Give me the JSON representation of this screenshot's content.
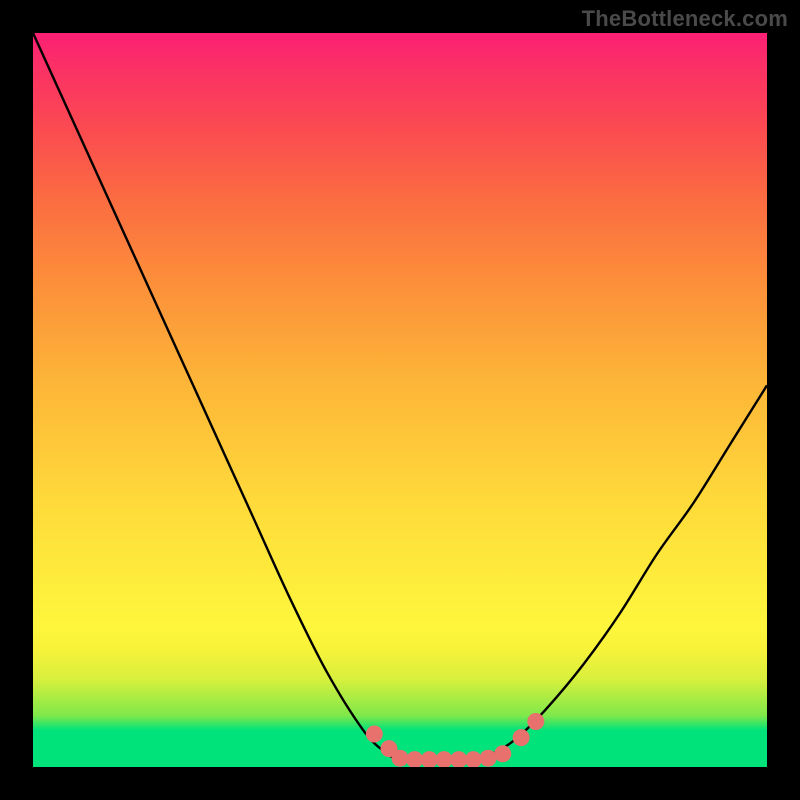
{
  "watermark": "TheBottleneck.com",
  "colors": {
    "curve_stroke": "#000000",
    "marker_fill": "#e8716e",
    "marker_stroke": "#d85a56",
    "background_black": "#000000"
  },
  "chart_data": {
    "type": "line",
    "title": "",
    "xlabel": "",
    "ylabel": "",
    "xlim": [
      0,
      100
    ],
    "ylim": [
      0,
      100
    ],
    "x": [
      0,
      5,
      10,
      15,
      20,
      25,
      30,
      35,
      40,
      45,
      48,
      50,
      53,
      56,
      60,
      63,
      66,
      70,
      75,
      80,
      85,
      90,
      95,
      100
    ],
    "values": [
      100,
      89,
      78,
      67,
      56,
      45,
      34,
      23,
      13,
      5,
      2,
      1,
      1,
      1,
      1,
      2,
      4,
      8,
      14,
      21,
      29,
      36,
      44,
      52
    ],
    "markers": {
      "x": [
        46.5,
        48.5,
        50,
        52,
        54,
        56,
        58,
        60,
        62,
        64,
        66.5,
        68.5
      ],
      "y": [
        4.5,
        2.5,
        1.2,
        1,
        1,
        1,
        1,
        1,
        1.2,
        1.8,
        4,
        6.2
      ]
    }
  }
}
